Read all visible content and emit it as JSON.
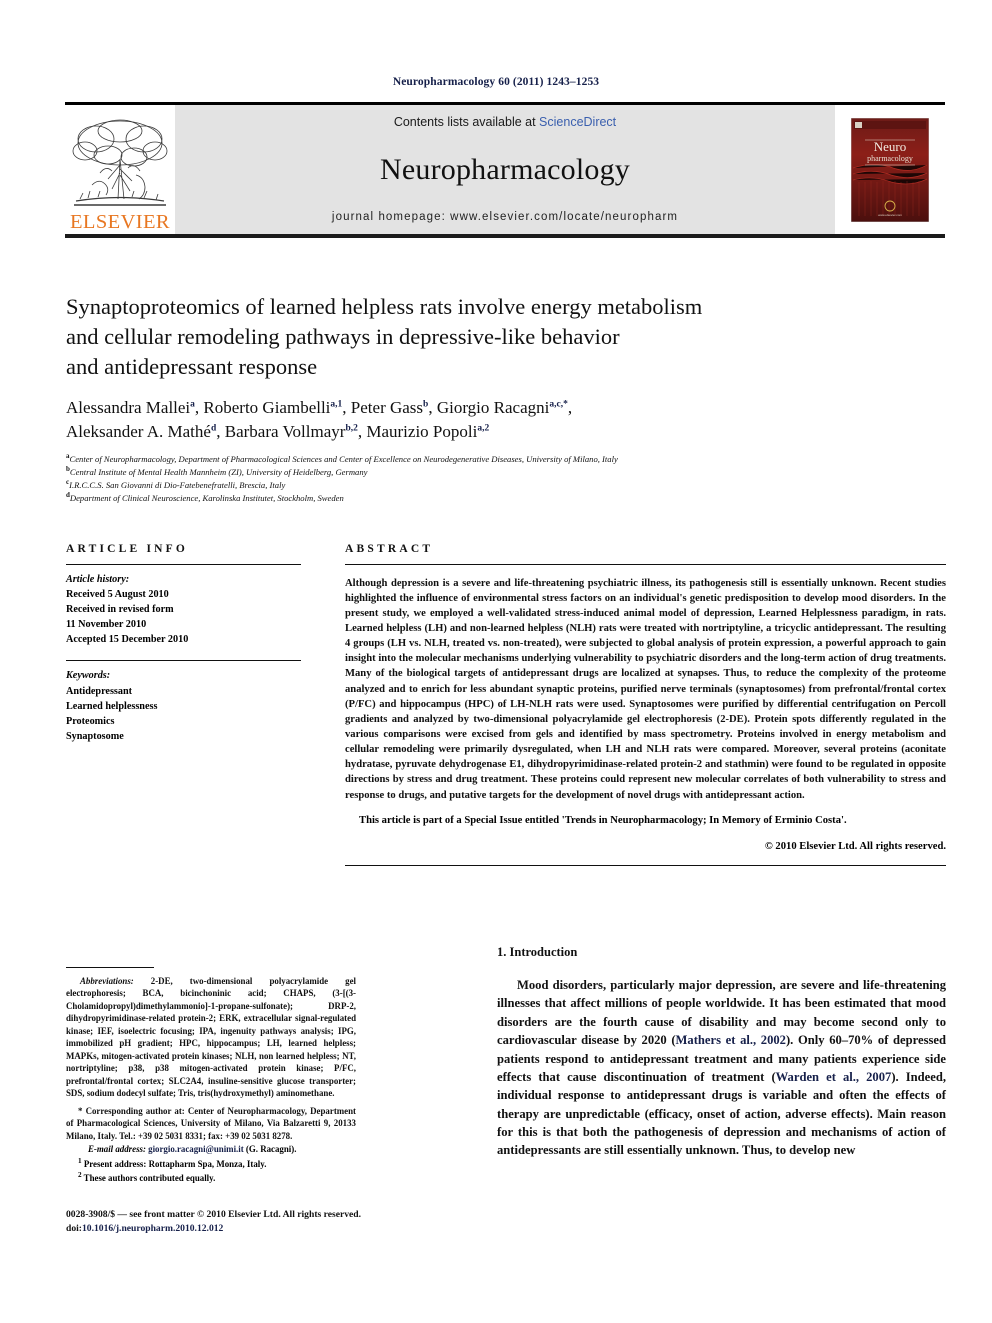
{
  "running_head": "Neuropharmacology 60 (2011) 1243–1253",
  "masthead": {
    "contents_prefix": "Contents lists available at ",
    "contents_link": "ScienceDirect",
    "journal_name": "Neuropharmacology",
    "homepage": "journal homepage: www.elsevier.com/locate/neuropharm",
    "publisher_wordmark": "ELSEVIER",
    "cover_title_line1": "Neuro",
    "cover_title_line2": "pharmacology",
    "accent_orange": "#E87722",
    "link_blue": "#3a5fae",
    "masthead_gray": "#e3e3e3"
  },
  "article": {
    "title_line1": "Synaptoproteomics of learned helpless rats involve energy metabolism",
    "title_line2": "and cellular remodeling pathways in depressive-like behavior",
    "title_line3": "and antidepressant response",
    "authors": [
      {
        "name": "Alessandra Mallei",
        "marks": "a"
      },
      {
        "name": "Roberto Giambelli",
        "marks": "a,1"
      },
      {
        "name": "Peter Gass",
        "marks": "b"
      },
      {
        "name": "Giorgio Racagni",
        "marks": "a,c,*"
      },
      {
        "name": "Aleksander A. Mathé",
        "marks": "d"
      },
      {
        "name": "Barbara Vollmayr",
        "marks": "b,2"
      },
      {
        "name": "Maurizio Popoli",
        "marks": "a,2"
      }
    ],
    "affiliations": [
      {
        "mark": "a",
        "text": "Center of Neuropharmacology, Department of Pharmacological Sciences and Center of Excellence on Neurodegenerative Diseases, University of Milano, Italy"
      },
      {
        "mark": "b",
        "text": "Central Institute of Mental Health Mannheim (ZI), University of Heidelberg, Germany"
      },
      {
        "mark": "c",
        "text": "I.R.C.C.S. San Giovanni di Dio-Fatebenefratelli, Brescia, Italy"
      },
      {
        "mark": "d",
        "text": "Department of Clinical Neuroscience, Karolinska Institutet, Stockholm, Sweden"
      }
    ]
  },
  "article_info": {
    "heading": "ARTICLE INFO",
    "history_label": "Article history:",
    "history": [
      "Received 5 August 2010",
      "Received in revised form",
      "11 November 2010",
      "Accepted 15 December 2010"
    ],
    "keywords_label": "Keywords:",
    "keywords": [
      "Antidepressant",
      "Learned helplessness",
      "Proteomics",
      "Synaptosome"
    ]
  },
  "abstract": {
    "heading": "ABSTRACT",
    "body": "Although depression is a severe and life-threatening psychiatric illness, its pathogenesis still is essentially unknown. Recent studies highlighted the influence of environmental stress factors on an individual's genetic predisposition to develop mood disorders. In the present study, we employed a well-validated stress-induced animal model of depression, Learned Helplessness paradigm, in rats. Learned helpless (LH) and non-learned helpless (NLH) rats were treated with nortriptyline, a tricyclic antidepressant. The resulting 4 groups (LH vs. NLH, treated vs. non-treated), were subjected to global analysis of protein expression, a powerful approach to gain insight into the molecular mechanisms underlying vulnerability to psychiatric disorders and the long-term action of drug treatments. Many of the biological targets of antidepressant drugs are localized at synapses. Thus, to reduce the complexity of the proteome analyzed and to enrich for less abundant synaptic proteins, purified nerve terminals (synaptosomes) from prefrontal/frontal cortex (P/FC) and hippocampus (HPC) of LH-NLH rats were used. Synaptosomes were purified by differential centrifugation on Percoll gradients and analyzed by two-dimensional polyacrylamide gel electrophoresis (2-DE). Protein spots differently regulated in the various comparisons were excised from gels and identified by mass spectrometry. Proteins involved in energy metabolism and cellular remodeling were primarily dysregulated, when LH and NLH rats were compared. Moreover, several proteins (aconitate hydratase, pyruvate dehydrogenase E1, dihydropyrimidinase-related protein-2 and stathmin) were found to be regulated in opposite directions by stress and drug treatment. These proteins could represent new molecular correlates of both vulnerability to stress and response to drugs, and putative targets for the development of novel drugs with antidepressant action.",
    "special_issue": "This article is part of a Special Issue entitled 'Trends in Neuropharmacology; In Memory of Erminio Costa'.",
    "copyright": "© 2010 Elsevier Ltd. All rights reserved."
  },
  "footnotes": {
    "abbreviations_label": "Abbreviations:",
    "abbreviations_text": " 2-DE, two-dimensional polyacrylamide gel electrophoresis; BCA, bicinchoninic acid; CHAPS, (3-[(3-Cholamidopropyl)dimethylammonio]-1-propane-sulfonate); DRP-2, dihydropyrimidinase-related protein-2; ERK, extracellular signal-regulated kinase; IEF, isoelectric focusing; IPA, ingenuity pathways analysis; IPG, immobilized pH gradient; HPC, hippocampus; LH, learned helpless; MAPKs, mitogen-activated protein kinases; NLH, non learned helpless; NT, nortriptyline; p38, p38 mitogen-activated protein kinase; P/FC, prefrontal/frontal cortex; SLC2A4, insuline-sensitive glucose transporter; SDS, sodium dodecyl sulfate; Tris, tris(hydroxymethyl) aminomethane.",
    "corresponding": "* Corresponding author at: Center of Neuropharmacology, Department of Pharmacological Sciences, University of Milano, Via Balzaretti 9, 20133 Milano, Italy. Tel.: +39 02 5031 8331; fax: +39 02 5031 8278.",
    "email_label": "E-mail address:",
    "email_address": "giorgio.racagni@unimi.it",
    "email_suffix": " (G. Racagni).",
    "note1_mark": "1",
    "note1": " Present address: Rottapharm Spa, Monza, Italy.",
    "note2_mark": "2",
    "note2": " These authors contributed equally."
  },
  "footer": {
    "issn_line": "0028-3908/$ — see front matter © 2010 Elsevier Ltd. All rights reserved.",
    "doi_prefix": "doi:",
    "doi": "10.1016/j.neuropharm.2010.12.012"
  },
  "introduction": {
    "heading": "1. Introduction",
    "para_part1": "Mood disorders, particularly major depression, are severe and life-threatening illnesses that affect millions of people worldwide. It has been estimated that mood disorders are the fourth cause of disability and may become second only to cardiovascular disease by 2020 (",
    "cite1": "Mathers et al., 2002",
    "para_part2": "). Only 60–70% of depressed patients respond to antidepressant treatment and many patients experience side effects that cause discontinuation of treatment (",
    "cite2": "Warden et al., 2007",
    "para_part3": "). Indeed, individual response to antidepressant drugs is variable and often the effects of therapy are unpredictable (efficacy, onset of action, adverse effects). Main reason for this is that both the pathogenesis of depression and mechanisms of action of antidepressants are still essentially unknown. Thus, to develop new"
  }
}
